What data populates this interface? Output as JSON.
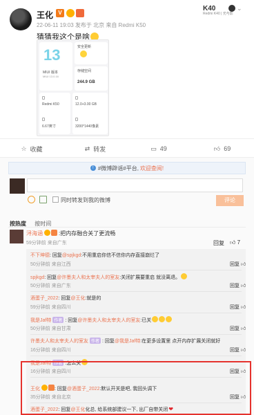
{
  "post": {
    "username": "王化",
    "v_badge": "V",
    "meta": "22-06-11 19:03 发布于 北京 来自 Redmi K50",
    "text": "猜猜我这个是啥",
    "device_badge": {
      "name": "K40",
      "sub": "Redmi K40 | 光与影"
    },
    "screenshot": {
      "miui_logo": "13",
      "miui_label": "MIUI 版本",
      "miui_version": "MIUI 13.0.16",
      "security_label": "安全更新",
      "storage_label": "存储空间",
      "storage_value": "244.9 GB",
      "device_name": "Redmi K50",
      "screen_size": "6.67英寸",
      "memory": "12.0+3.00 GB",
      "resolution": "3200*1440像素"
    }
  },
  "actions": {
    "favorite": {
      "icon": "star-icon",
      "label": "收藏"
    },
    "repost": {
      "icon": "repost-icon",
      "label": "转发"
    },
    "comment": {
      "icon": "comment-icon",
      "count": "49"
    },
    "like": {
      "icon": "thumbs-up-icon",
      "count": "69"
    }
  },
  "composer": {
    "notice_prefix": "#微博辟谣#平台,",
    "notice_link": "欢迎查阅!",
    "also_repost_label": "同时转发到我的微博",
    "submit_label": "评论"
  },
  "sort": {
    "hot": "按热度",
    "time": "按时间"
  },
  "comment": {
    "author": "浔海涵",
    "text": ":把内存融合关了更流畅",
    "time": "59分钟前",
    "location": "来自广东",
    "reply_label": "回复",
    "likes": "7"
  },
  "replies": [
    {
      "name": "不下坤德",
      "reply_word": "回复",
      "target": "@spjkgd",
      "text": ":不用重启你信不信你内存直接崩烂了",
      "time": "50分钟前",
      "location": "来自江西",
      "likes": ""
    },
    {
      "name": "spjkgd",
      "reply_word": "回复",
      "target": "@许墨夫人和太宰夫人的室友",
      "text": ":关闭扩展要重启 就没离退。",
      "time": "50分钟前",
      "location": "来自广东",
      "likes": ""
    },
    {
      "name": "酒蛋子_2022",
      "reply_word": "回复",
      "target": "@王化",
      "text": ":就是的",
      "time": "59分钟前",
      "location": "来自四川",
      "likes": ""
    },
    {
      "name": "我是Jaf特",
      "tag": "作者",
      "reply_word": "回复",
      "target": "@许墨夫人和太宰夫人的室友",
      "text": ":已关",
      "time": "50分钟前",
      "location": "来自甘肃",
      "likes": ""
    },
    {
      "name": "许墨夫人和太宰夫人的室友",
      "tag": "作者",
      "reply_word": "回复",
      "target": "@我是Jaf特",
      "text": ":在更多设置里 点开内存扩展关闭就好",
      "time": "16分钟前",
      "location": "来自四川",
      "likes": ""
    },
    {
      "name": "我是Jaf特",
      "tag": "作者",
      "reply_word": "",
      "target": "",
      "text": ":怎么关",
      "time": "16分钟前",
      "location": "来自四川",
      "likes": ""
    },
    {
      "name": "王化",
      "reply_word": "回复",
      "target": "@酒蛋子_2022",
      "text": ":默认开关是吧, 我回头调下",
      "time": "35分钟前",
      "location": "来自北京",
      "likes": ""
    },
    {
      "name": "酒蛋子_2022",
      "reply_word": "回复",
      "target": "@王化",
      "text": "化总, 给系统部建议一下, 出厂自带关闭",
      "time": "",
      "location": "",
      "likes": ""
    }
  ],
  "labels": {
    "reply": "回复",
    "like": "赞"
  }
}
